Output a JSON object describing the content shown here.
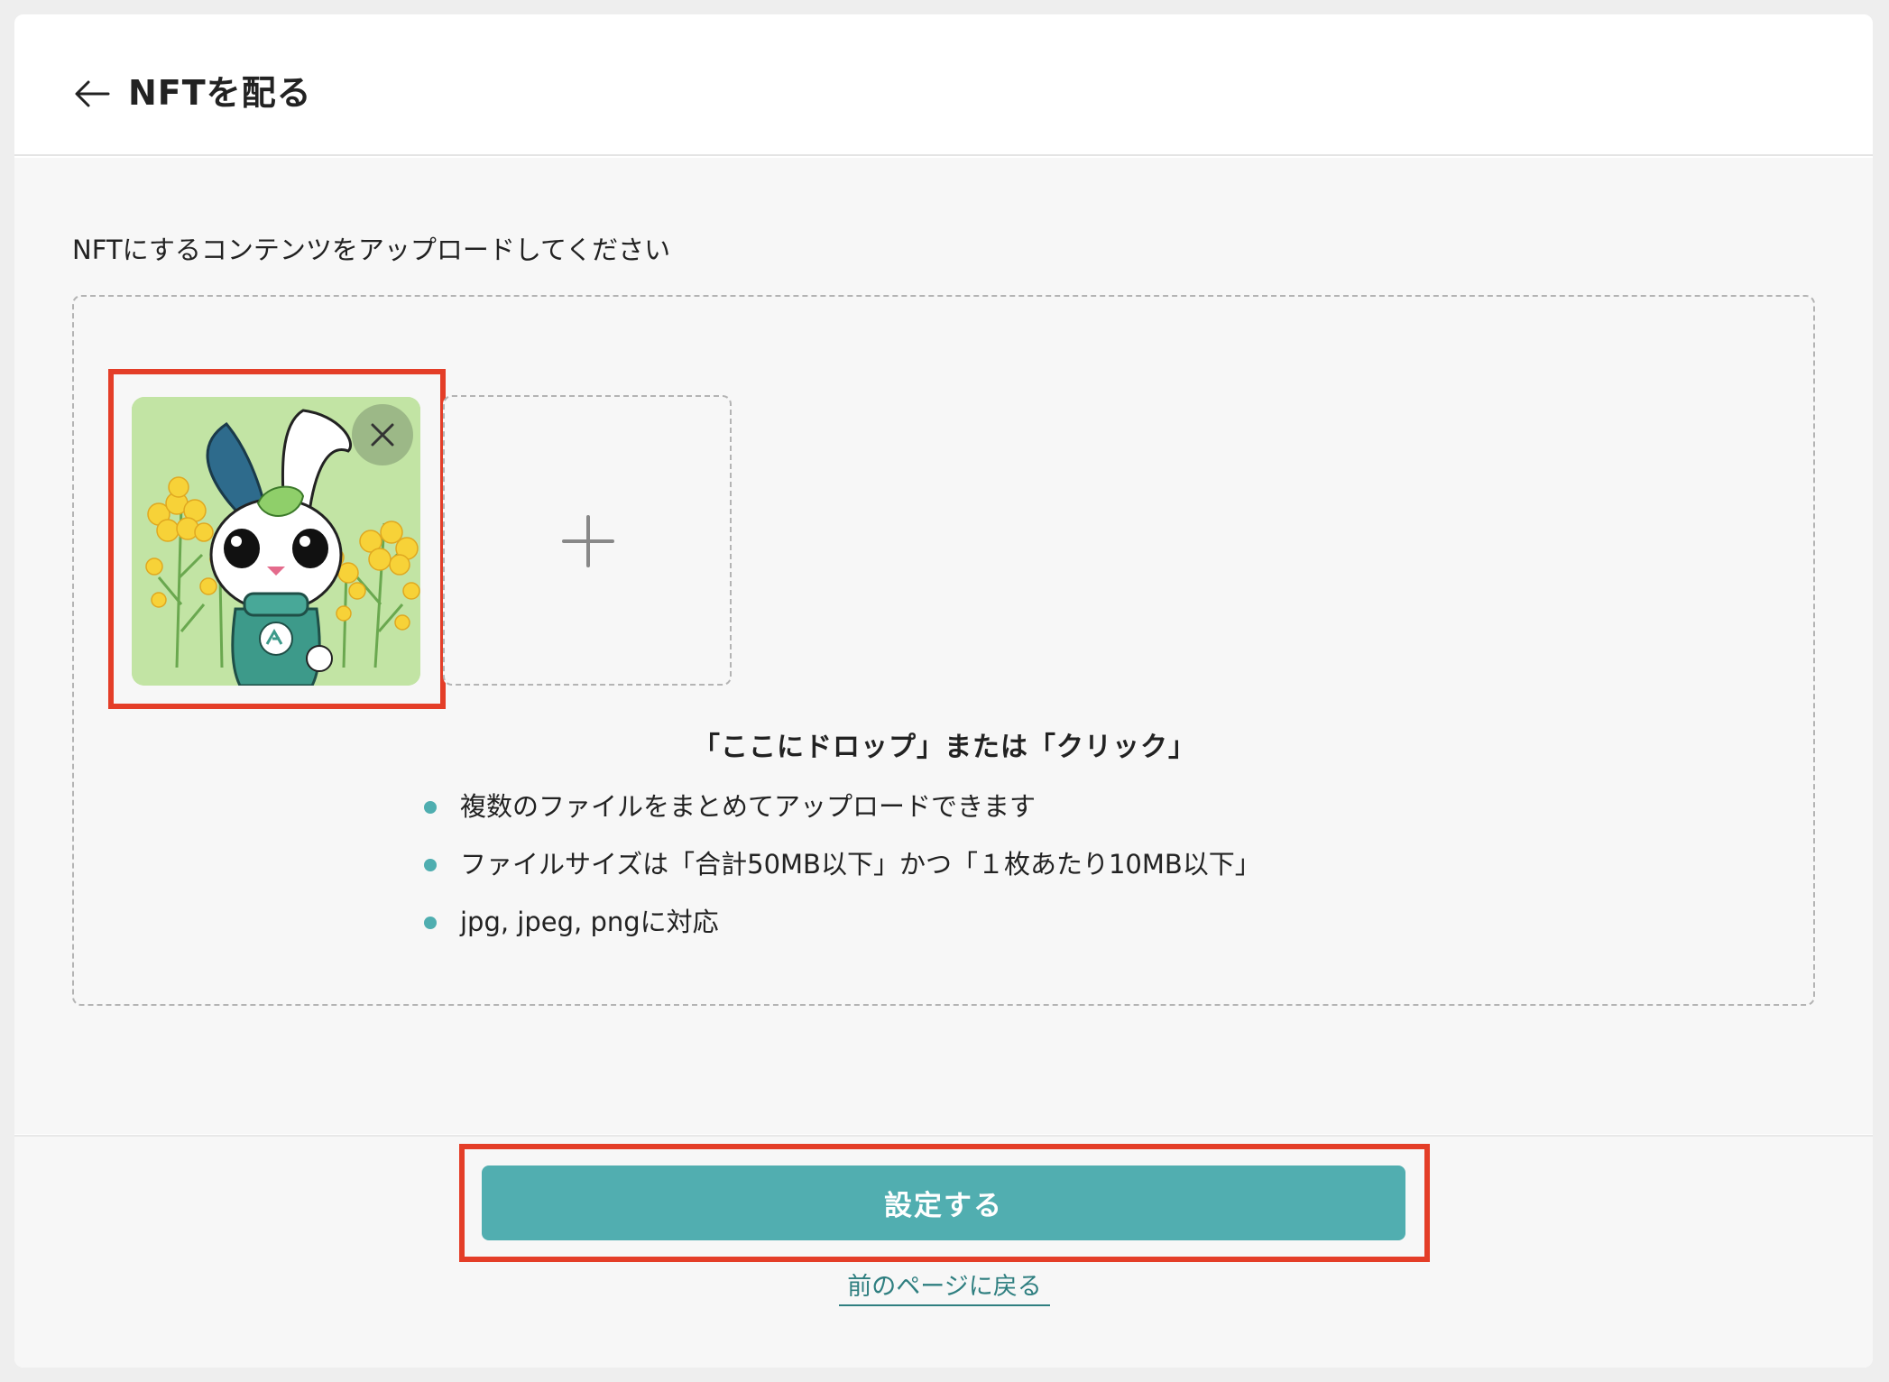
{
  "header": {
    "title": "NFTを配る",
    "back_icon": "arrow-left-icon"
  },
  "main": {
    "instruction": "NFTにするコンテンツをアップロードしてください",
    "dropzone": {
      "heading": "「ここにドロップ」または「クリック」",
      "bullets": [
        "複数のファイルをまとめてアップロードできます",
        "ファイルサイズは「合計50MB以下」かつ「１枚あたり10MB以下」",
        "jpg, jpeg, pngに対応"
      ],
      "uploaded_image": "rabbit-character-thumbnail",
      "remove_icon": "close-icon",
      "add_icon": "plus-icon"
    }
  },
  "footer": {
    "submit_label": "設定する",
    "back_link": "前のページに戻る"
  },
  "colors": {
    "accent": "#51aeb0",
    "highlight": "#e43e28",
    "bullet": "#4faeb0"
  }
}
